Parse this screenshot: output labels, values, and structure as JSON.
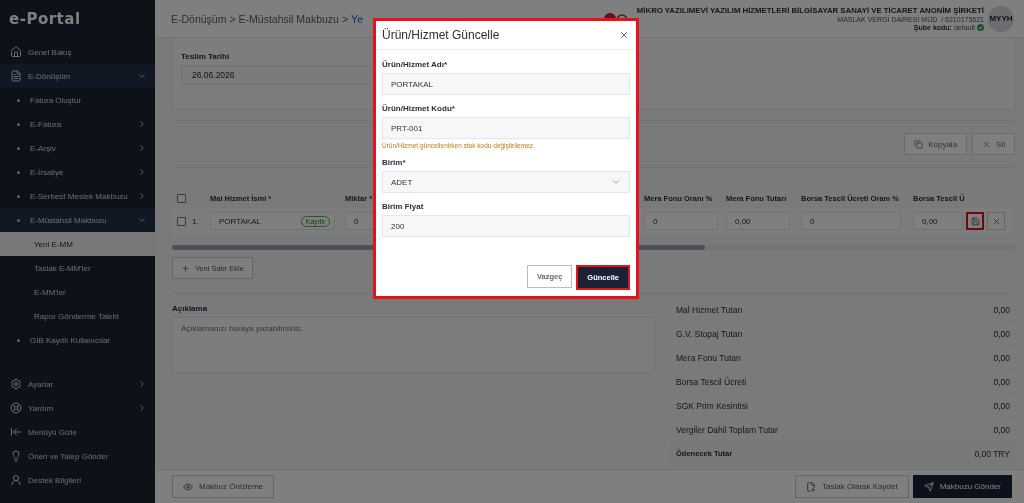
{
  "sidebar": {
    "logo": "e-Portal",
    "items": [
      {
        "label": "Genel Bakış",
        "selected": false
      },
      {
        "label": "E-Dönüşüm",
        "selected": false,
        "expanded": true,
        "children": [
          {
            "label": "Fatura Oluştur",
            "selected": false
          },
          {
            "label": "E-Fatura",
            "selected": false,
            "expanded": false
          },
          {
            "label": "E-Arşiv",
            "selected": false,
            "expanded": false
          },
          {
            "label": "E-İrsaliye",
            "selected": false,
            "expanded": false
          },
          {
            "label": "E-Serbest Meslek Makbuzu",
            "selected": false,
            "expanded": false
          },
          {
            "label": "E-Müstahsil Makbuzu",
            "selected": false,
            "expanded": true,
            "children": [
              {
                "label": "Yeni E-MM",
                "selected": true
              },
              {
                "label": "Taslak E-MM'ler",
                "selected": false
              },
              {
                "label": "E-MM'ler",
                "selected": false
              },
              {
                "label": "Rapor Gönderme Talebi",
                "selected": false
              }
            ]
          },
          {
            "label": "GİB Kayıtlı Kullanıcılar",
            "selected": false
          }
        ]
      }
    ],
    "footer_items": [
      {
        "label": "Ayarlar",
        "selected": false,
        "expanded": false
      },
      {
        "label": "Yardım",
        "selected": false,
        "expanded": false
      },
      {
        "label": "Menüyü Gizle",
        "selected": false
      },
      {
        "label": "Öneri ve Talep Gönder",
        "selected": false
      },
      {
        "label": "Destek Bilgileri",
        "selected": false
      }
    ]
  },
  "header": {
    "breadcrumb": [
      "E-Dönüşüm",
      "E-Müstahsil Makbuzu",
      "Ye"
    ],
    "separator": ">",
    "company": "MİKRO YAZILIMEVİ YAZILIM HİZMETLERİ BİLGİSAYAR SANAYİ VE TİCARET ANONİM ŞİRKETİ",
    "tax_office": "MASLAK VERGİ DAİRESİ MÜD. / 6210175621",
    "branch_label": "Şube kodu:",
    "branch_value": "default",
    "avatar": "MYYH"
  },
  "delivery": {
    "label": "Teslim Tarihi",
    "value": "26.06.2026"
  },
  "table_actions": [
    "Kopyala",
    "Sil"
  ],
  "table": {
    "all_checked": false,
    "columns": [
      "Mal Hizmet İsmi *",
      "Miktar *",
      "Mera Fonu Oranı %",
      "Mera Fonu Tutarı",
      "Borsa Tescil Ücreti Oranı %",
      "Borsa Tescil Ü"
    ],
    "rows": [
      {
        "checked": false,
        "number": "1.",
        "name": "PORTAKAL",
        "badge": "Kayıtlı",
        "values": [
          "0",
          "0",
          "0,00",
          "0",
          "0,00"
        ],
        "save_highlighted": true
      }
    ]
  },
  "add_row": "Yeni Satır Ekle",
  "description": {
    "label": "Açıklama",
    "placeholder": "Açıklamanızı buraya yazabilirsiniz."
  },
  "summary": {
    "rows": [
      {
        "label": "Mal Hizmet Tutarı",
        "value": "0,00"
      },
      {
        "label": "G.V. Stopaj Tutarı",
        "value": "0,00"
      },
      {
        "label": "Mera Fonu Tutarı",
        "value": "0,00"
      },
      {
        "label": "Borsa Tescil Ücreti",
        "value": "0,00"
      },
      {
        "label": "SGK Prim Kesintisi",
        "value": "0,00"
      },
      {
        "label": "Vergiler Dahil Toplam Tutar",
        "value": "0,00"
      }
    ],
    "total": {
      "label": "Ödenecek Tutar",
      "value": "0,00 TRY"
    }
  },
  "footer": {
    "preview": "Makbuz Önizleme",
    "draft": "Taslak Olarak Kaydet",
    "send": "Makbuzu Gönder"
  },
  "modal": {
    "title": "Ürün/Hizmet Güncelle",
    "highlighted": true,
    "fields": [
      {
        "kind": "text",
        "label": "Ürün/Hizmet Adı*",
        "value": "PORTAKAL"
      },
      {
        "kind": "text",
        "label": "Ürün/Hizmet Kodu*",
        "value": "PRT-001",
        "hint": "Ürün/Hizmet güncellenirken stok kodu değiştirilemez."
      },
      {
        "kind": "select",
        "label": "Birim*",
        "value": "ADET"
      },
      {
        "kind": "text",
        "label": "Birim Fiyat",
        "value": "200"
      }
    ],
    "cancel": "Vazgeç",
    "confirm": "Güncelle",
    "confirm_highlighted": true
  }
}
